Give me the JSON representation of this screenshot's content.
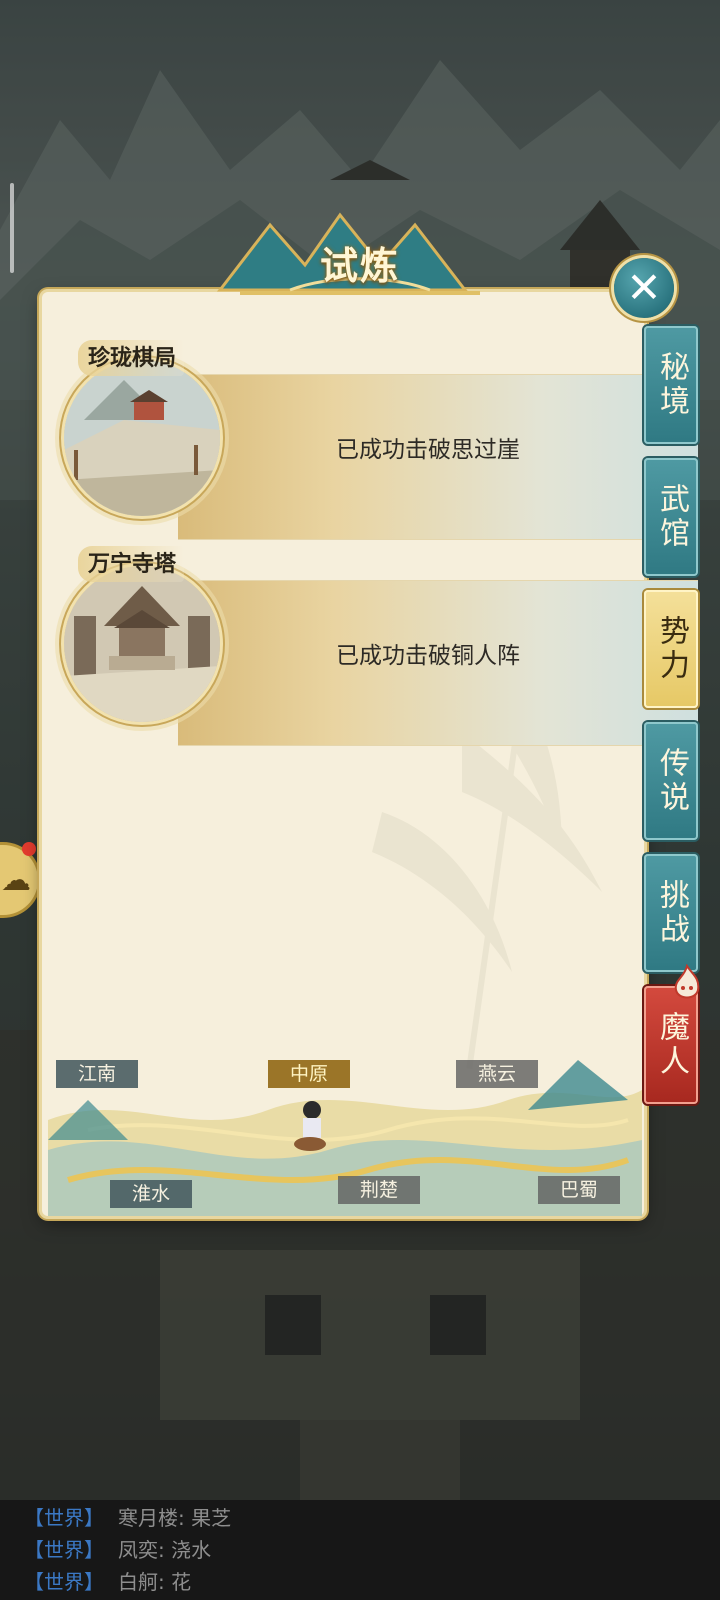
{
  "title": "试炼",
  "close_icon": "close-icon",
  "trials": [
    {
      "name": "珍珑棋局",
      "status": "已成功击破思过崖"
    },
    {
      "name": "万宁寺塔",
      "status": "已成功击破铜人阵"
    }
  ],
  "tabs": [
    {
      "label": "秘境",
      "state": "normal"
    },
    {
      "label": "武馆",
      "state": "normal"
    },
    {
      "label": "势力",
      "state": "active"
    },
    {
      "label": "传说",
      "state": "normal"
    },
    {
      "label": "挑战",
      "state": "normal"
    },
    {
      "label": "魔人",
      "state": "special"
    }
  ],
  "regions": {
    "jiangnan": "江南",
    "zhongyuan": "中原",
    "yanyun": "燕云",
    "huaishui": "淮水",
    "jingchu": "荆楚",
    "bashu": "巴蜀"
  },
  "selected_region": "中原",
  "chat": [
    {
      "channel": "【世界】",
      "text": "寒月楼: 果芝"
    },
    {
      "channel": "【世界】",
      "text": "凤奕: 浇水"
    },
    {
      "channel": "【世界】",
      "text": "白舸: 花"
    }
  ],
  "colors": {
    "accent_teal": "#2f7983",
    "accent_gold": "#e6c865",
    "accent_red": "#a7281f",
    "channel_blue": "#3b78c4"
  }
}
